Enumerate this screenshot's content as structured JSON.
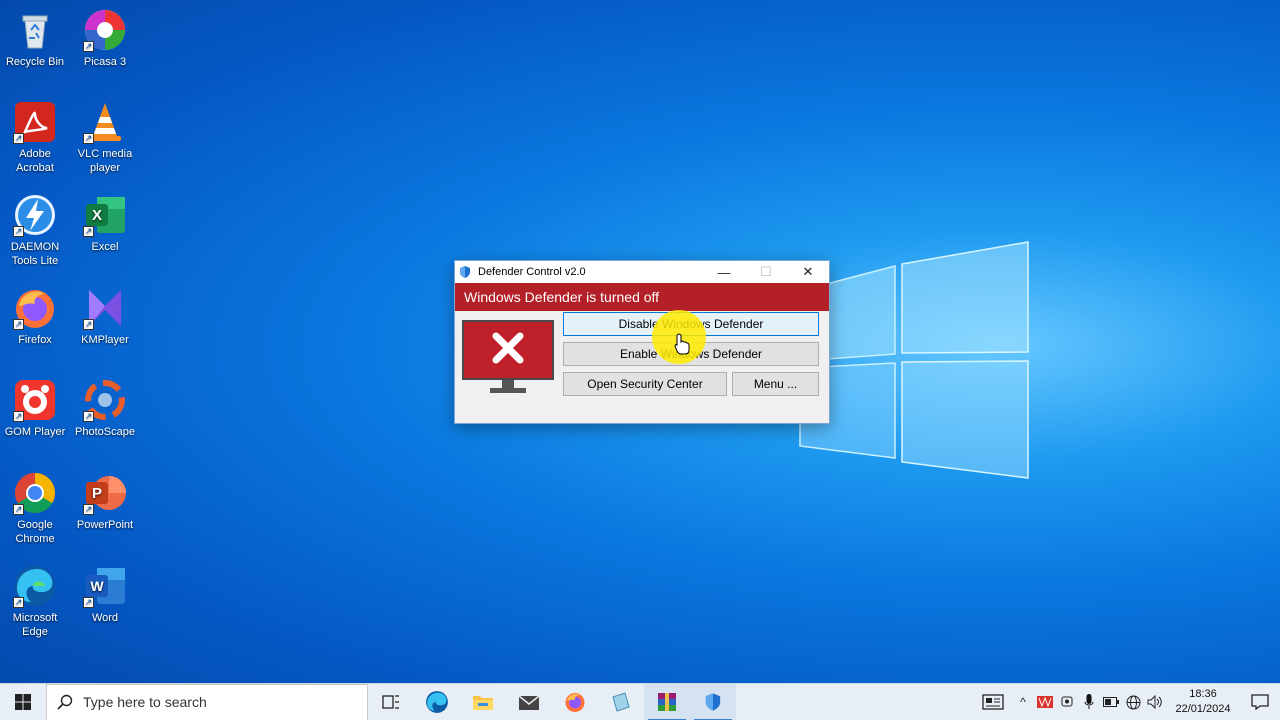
{
  "desktop": {
    "icons": [
      {
        "label": "Recycle Bin",
        "icon": "recycle-bin-icon"
      },
      {
        "label": "Picasa 3",
        "icon": "picasa-icon"
      },
      {
        "label": "Adobe Acrobat",
        "icon": "adobe-acrobat-icon"
      },
      {
        "label": "VLC media player",
        "icon": "vlc-icon"
      },
      {
        "label": "DAEMON Tools Lite",
        "icon": "daemon-tools-icon"
      },
      {
        "label": "Excel",
        "icon": "excel-icon"
      },
      {
        "label": "Firefox",
        "icon": "firefox-icon"
      },
      {
        "label": "KMPlayer",
        "icon": "kmplayer-icon"
      },
      {
        "label": "GOM Player",
        "icon": "gom-player-icon"
      },
      {
        "label": "PhotoScape",
        "icon": "photoscape-icon"
      },
      {
        "label": "Google Chrome",
        "icon": "chrome-icon"
      },
      {
        "label": "PowerPoint",
        "icon": "powerpoint-icon"
      },
      {
        "label": "Microsoft Edge",
        "icon": "edge-icon"
      },
      {
        "label": "Word",
        "icon": "word-icon"
      }
    ]
  },
  "window": {
    "title": "Defender Control v2.0",
    "status_text": "Windows Defender is turned off",
    "status_color": "#b32027",
    "buttons": {
      "disable": "Disable Windows Defender",
      "enable": "Enable Windows Defender",
      "security_center": "Open Security Center",
      "menu": "Menu ..."
    }
  },
  "taskbar": {
    "search_placeholder": "Type here to search",
    "apps": [
      "task-view-icon",
      "edge-icon",
      "file-explorer-icon",
      "mail-icon",
      "firefox-icon",
      "app-icon",
      "winrar-icon",
      "defender-control-icon"
    ],
    "clock_time": "18:36",
    "clock_date": "22/01/2024"
  }
}
